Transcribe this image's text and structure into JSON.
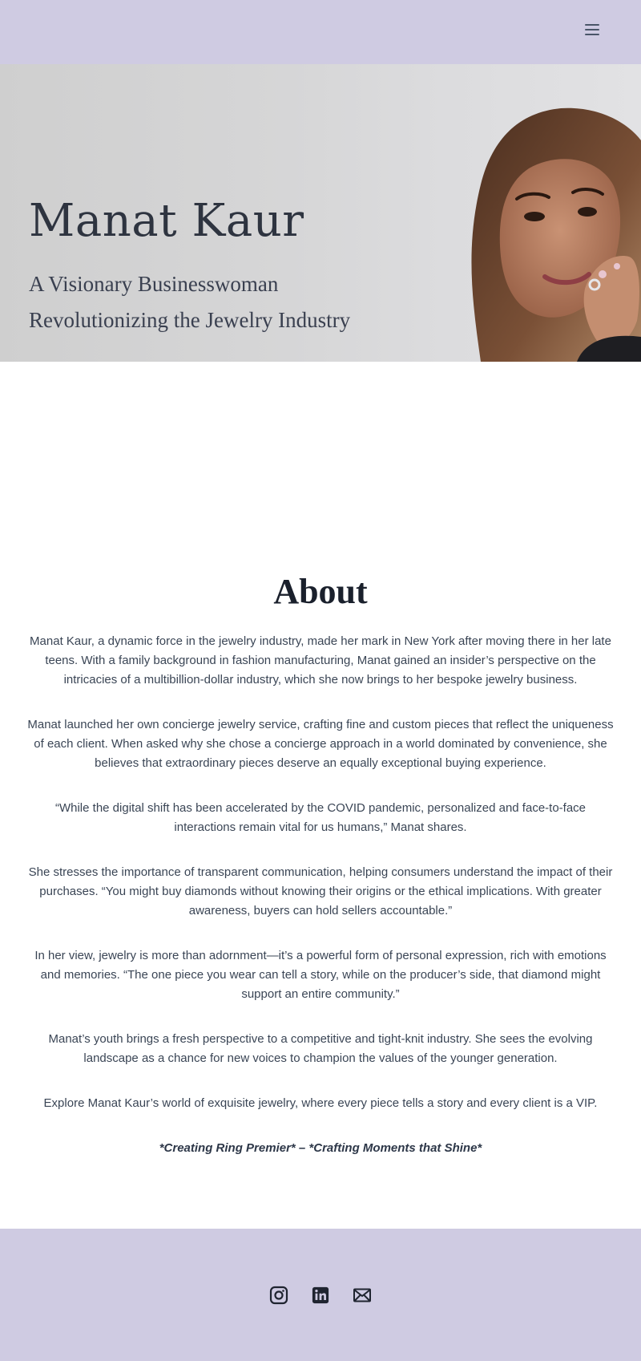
{
  "header": {
    "menu_icon": "hamburger-menu-icon"
  },
  "hero": {
    "title": "Manat Kaur",
    "subtitle_line1": "A Visionary Businesswoman",
    "subtitle_line2": "Revolutionizing the Jewelry Industry"
  },
  "about": {
    "heading": "About",
    "paragraphs": [
      "Manat Kaur, a dynamic force in the jewelry industry, made her mark in New York after moving there in her late teens. With a family background in fashion manufacturing, Manat gained an insider’s perspective on the intricacies of a multibillion-dollar industry, which she now brings to her bespoke jewelry business.",
      "Manat launched her own concierge jewelry service, crafting fine and custom pieces that reflect the uniqueness of each client. When asked why she chose a concierge approach in a world dominated by convenience, she believes that extraordinary pieces deserve an equally exceptional buying experience.",
      "“While the digital shift has been accelerated by the COVID pandemic, personalized and face-to-face interactions remain vital for us humans,” Manat shares.",
      "She stresses the importance of transparent communication, helping consumers understand the impact of their purchases. “You might buy diamonds without knowing their origins or the ethical implications. With greater awareness, buyers can hold sellers accountable.”",
      "In her view, jewelry is more than adornment—it’s a powerful form of personal expression, rich with emotions and memories. “The one piece you wear can tell a story, while on the producer’s side, that diamond might support an entire community.”",
      "Manat’s youth brings a fresh perspective to a competitive and tight-knit industry. She sees the evolving landscape as a chance for new voices to champion the values of the younger generation.",
      "Explore Manat Kaur’s world of exquisite jewelry, where every piece tells a story and every client is a VIP."
    ],
    "tagline": "*Creating Ring Premier* – *Crafting Moments that Shine*"
  },
  "footer": {
    "social_icons": [
      "instagram-icon",
      "linkedin-icon",
      "email-icon"
    ]
  },
  "colors": {
    "header_bg": "#cfcbe2",
    "footer_bg": "#cfcbe2",
    "text": "#2d3748"
  }
}
